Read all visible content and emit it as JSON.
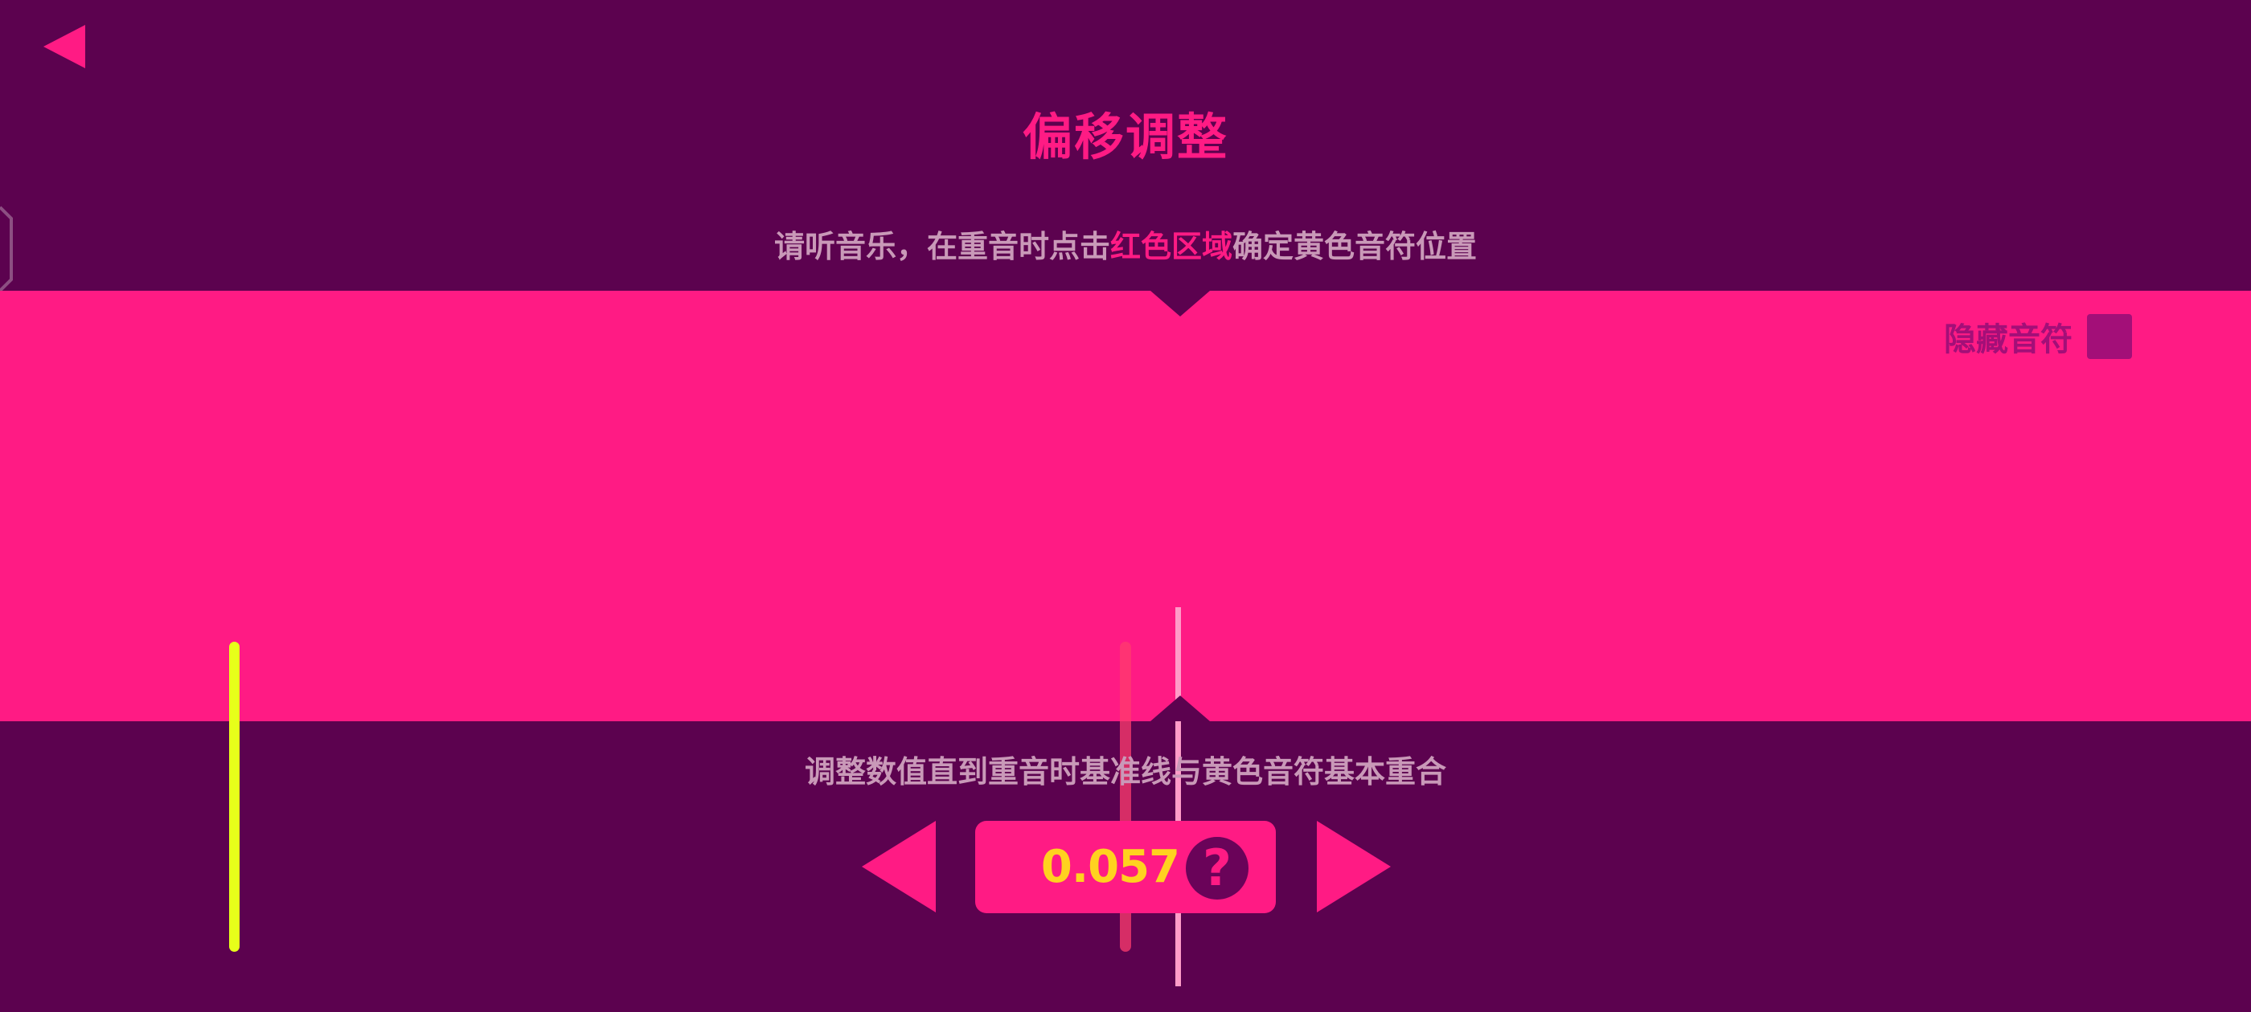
{
  "title": "偏移调整",
  "instruction": {
    "before": "请听音乐，在重音时点击",
    "highlight": "红色区域",
    "after": "确定黄色音符位置"
  },
  "hide_notes": {
    "label": "隐藏音符",
    "checked": false
  },
  "hint": "调整数值直到重音时基准线与黄色音符基本重合",
  "offset": {
    "value": "0.057",
    "help_symbol": "?"
  },
  "icons": {
    "back": "back-arrow-icon",
    "decrease": "left-triangle-icon",
    "increase": "right-triangle-icon",
    "help": "question-mark-icon"
  },
  "colors": {
    "background": "#5c024f",
    "accent": "#ff1b84",
    "note": "#e7ff1a",
    "value": "#ffd21f",
    "muted_text": "#c999b8",
    "checkbox": "#a30f78"
  }
}
